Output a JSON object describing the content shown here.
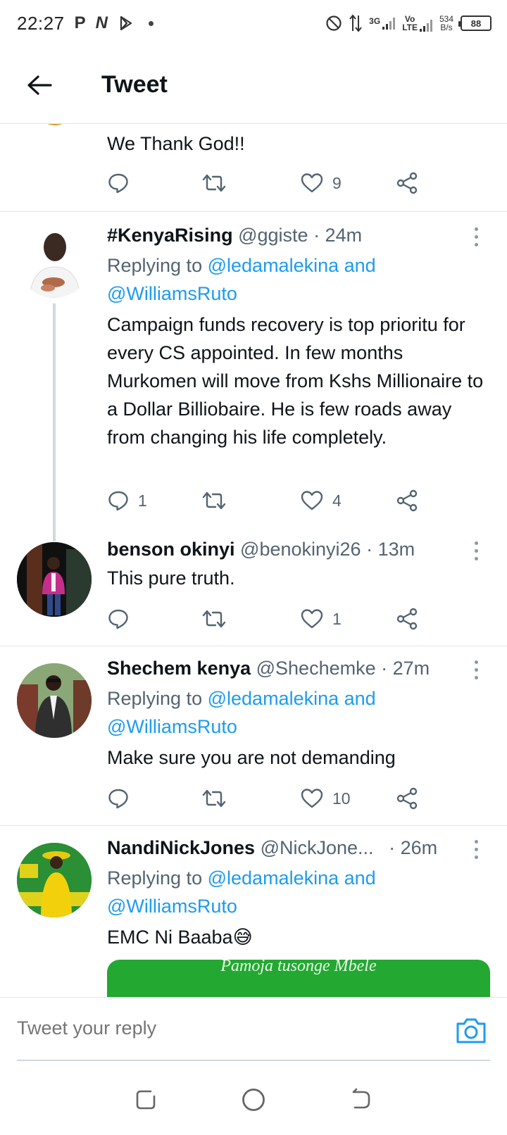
{
  "status_bar": {
    "time": "22:27",
    "app_icons": [
      "P",
      "N"
    ],
    "net_3g": "3G",
    "volte_top": "Vo",
    "volte_bottom": "LTE",
    "speed_value": "534",
    "speed_unit": "B/s",
    "battery": "88"
  },
  "header": {
    "title": "Tweet"
  },
  "top_tweet": {
    "text": "We Thank God!!",
    "likes": "9"
  },
  "tweets": [
    {
      "name": "#KenyaRising",
      "handle": "@ggiste",
      "time": "· 24m",
      "replying_prefix": "Replying to",
      "replying_line1": "@ledamalekina and",
      "replying_line2": "@WilliamsRuto",
      "text": "Campaign funds recovery is top prioritu for every CS appointed. In few months Murkomen will move from Kshs Millionaire to a Dollar Billiobaire. He is few roads away from changing his life completely.",
      "replies": "1",
      "likes": "4"
    },
    {
      "name": "benson okinyi",
      "handle": "@benokinyi26",
      "time": "· 13m",
      "text": "This pure truth.",
      "likes": "1"
    },
    {
      "name": "Shechem kenya",
      "handle": "@Shechemke",
      "time": "· 27m",
      "replying_prefix": "Replying to",
      "replying_line1": "@ledamalekina and",
      "replying_line2": "@WilliamsRuto",
      "text": "Make sure you are not demanding",
      "likes": "10"
    },
    {
      "name": "NandiNickJones",
      "handle": "@NickJone...",
      "time": "· 26m",
      "replying_prefix": "Replying to",
      "replying_line1": "@ledamalekina and",
      "replying_line2": "@WilliamsRuto",
      "text": "EMC Ni Baaba",
      "emoji": "😅",
      "media_caption": "Pamoja tusonge Mbele"
    }
  ],
  "reply_bar": {
    "placeholder": "Tweet your reply"
  },
  "colors": {
    "accent": "#1d9bf0",
    "text": "#0f1419",
    "muted": "#536471",
    "border": "#e6e6e6"
  }
}
